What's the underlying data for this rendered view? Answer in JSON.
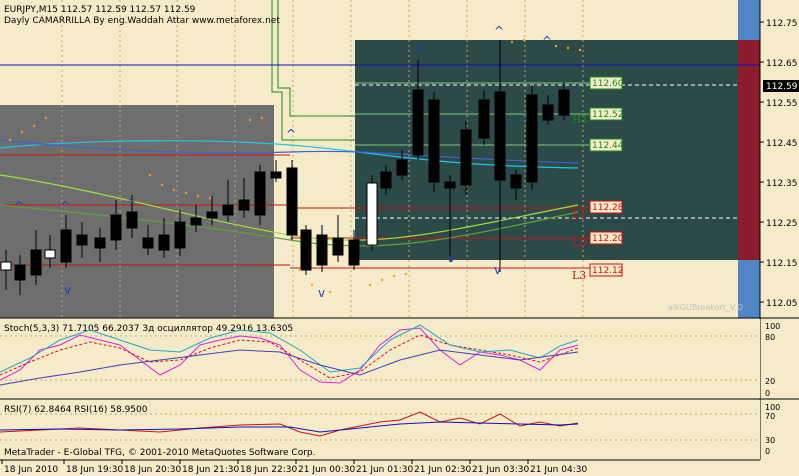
{
  "header": {
    "symbol_line": "EURJPY,M15  112.57 112.59 112.57 112.59",
    "indicator_line": "Dayly CAMARRILLA By eng.Waddah Attar  www.metaforex.net"
  },
  "price_scale": {
    "ticks": [
      "112.75",
      "112.65",
      "112.55",
      "112.45",
      "112.35",
      "112.25",
      "112.15",
      "112.05"
    ],
    "current_price": "112.59"
  },
  "levels": [
    {
      "label": "112.60",
      "color": "#1a8a1a"
    },
    {
      "label": "112.52",
      "color": "#1a8a1a"
    },
    {
      "label": "112.44",
      "color": "#1a8a1a"
    },
    {
      "label": "112.28",
      "color": "#d01010"
    },
    {
      "label": "112.20",
      "color": "#d01010"
    },
    {
      "label": "112.12",
      "color": "#d01010"
    }
  ],
  "level_tags": {
    "h1": "H1",
    "l1": "L1",
    "l2": "L2",
    "l3": "L3"
  },
  "watermark": "alkGUBreakort_V.D",
  "stoch": {
    "title": "Stoch(5,3,3) 71.7105 66.2037  Зд осциллятор 49.2916 13.6305",
    "ticks": [
      "100",
      "80",
      "20",
      "0"
    ]
  },
  "rsi": {
    "title": "RSI(7) 62.8464  RSI(16) 58.9500",
    "ticks": [
      "100",
      "70",
      "30",
      "0"
    ]
  },
  "copyright": "MetaTrader - E-Global TFG, © 2001-2010 MetaQuotes Software Corp.",
  "time_axis": [
    "18 Jun 2010",
    "18 Jun 19:30",
    "18 Jun 20:30",
    "18 Jun 21:30",
    "18 Jun 22:30",
    "21 Jun 00:30",
    "21 Jun 01:30",
    "21 Jun 02:30",
    "21 Jun 03:30",
    "21 Jun 04:30"
  ],
  "colors": {
    "background": "#f5ebc8",
    "grey_box": "#6e6e6e",
    "teal_box": "#2c4a48",
    "bull_body": "#ffffff",
    "bear_body": "#000000",
    "stoch_main": "#e020e0",
    "stoch_signal": "#e01010",
    "stoch_alt": "#20a8c0",
    "rsi_fast": "#d01010",
    "rsi_slow": "#1010c0"
  }
}
